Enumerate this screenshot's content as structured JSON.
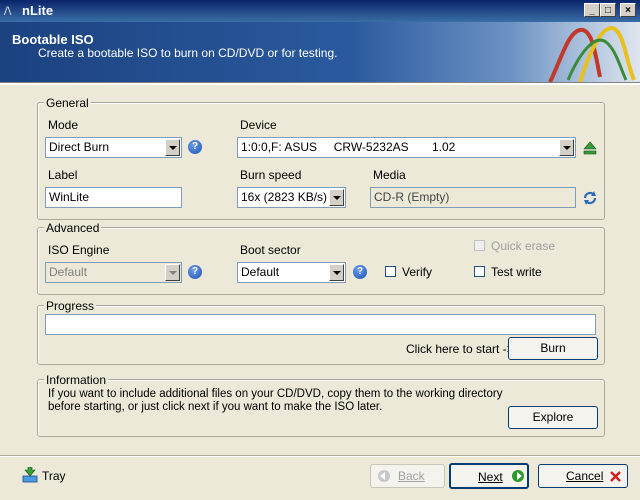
{
  "window": {
    "title": "nLite"
  },
  "header": {
    "title": "Bootable ISO",
    "subtitle": "Create a bootable ISO to burn on CD/DVD or for testing."
  },
  "general": {
    "legend": "General",
    "mode_label": "Mode",
    "mode_value": "Direct Burn",
    "device_label": "Device",
    "device_value": "1:0:0,F: ASUS     CRW-5232AS       1.02",
    "label_label": "Label",
    "label_value": "WinLite",
    "burn_speed_label": "Burn speed",
    "burn_speed_value": "16x (2823 KB/s)",
    "media_label": "Media",
    "media_value": "CD-R (Empty)"
  },
  "advanced": {
    "legend": "Advanced",
    "iso_engine_label": "ISO Engine",
    "iso_engine_value": "Default",
    "boot_sector_label": "Boot sector",
    "boot_sector_value": "Default",
    "verify_label": "Verify",
    "quick_erase_label": "Quick erase",
    "test_write_label": "Test write"
  },
  "progress": {
    "legend": "Progress",
    "hint": "Click here to start ->",
    "burn_label": "Burn"
  },
  "information": {
    "legend": "Information",
    "line1": "If you want to include additional files on your CD/DVD, copy them to the working directory",
    "line2": "before starting, or just click next if you want to make the ISO later.",
    "explore_label": "Explore"
  },
  "footer": {
    "tray_label": "Tray",
    "back_label": "Back",
    "next_label": "Next",
    "cancel_label": "Cancel"
  },
  "help_glyph": "?",
  "icons": [
    "app-icon",
    "minimize-icon",
    "maximize-icon",
    "close-icon",
    "help-icon",
    "eject-icon",
    "refresh-icon",
    "tray-icon",
    "back-arrow-icon",
    "next-arrow-icon",
    "cancel-x-icon"
  ]
}
